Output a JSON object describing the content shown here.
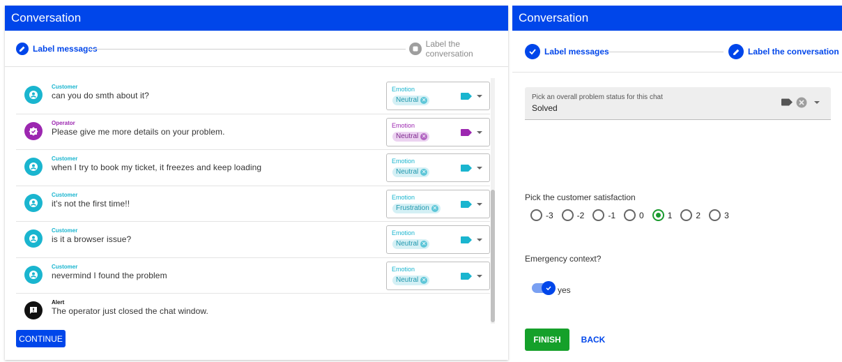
{
  "left_panel": {
    "title": "Conversation",
    "steps": [
      {
        "label": "Label messages",
        "state": "active"
      },
      {
        "label": "Label the conversation",
        "state": "inactive"
      }
    ],
    "messages": [
      {
        "sender": "Customer",
        "text": "can you do smth about it?",
        "emotion_label": "Emotion",
        "emotion": "Neutral"
      },
      {
        "sender": "Operator",
        "text": "Please give me more details on your problem.",
        "emotion_label": "Emotion",
        "emotion": "Neutral"
      },
      {
        "sender": "Customer",
        "text": "when I try to book my ticket, it freezes and keep loading",
        "emotion_label": "Emotion",
        "emotion": "Neutral"
      },
      {
        "sender": "Customer",
        "text": "it's not the first time!!",
        "emotion_label": "Emotion",
        "emotion": "Frustration"
      },
      {
        "sender": "Customer",
        "text": "is it a browser issue?",
        "emotion_label": "Emotion",
        "emotion": "Neutral"
      },
      {
        "sender": "Customer",
        "text": "nevermind I found the problem",
        "emotion_label": "Emotion",
        "emotion": "Neutral"
      }
    ],
    "alert": {
      "sender": "Alert",
      "text": "The operator just closed the chat window."
    },
    "continue_label": "CONTINUE"
  },
  "right_panel": {
    "title": "Conversation",
    "steps": [
      {
        "label": "Label messages",
        "state": "done"
      },
      {
        "label": "Label the conversation",
        "state": "active"
      }
    ],
    "problem_status": {
      "label": "Pick an overall problem status for this chat",
      "value": "Solved"
    },
    "satisfaction": {
      "label": "Pick the customer satisfaction",
      "options": [
        "-3",
        "-2",
        "-1",
        "0",
        "1",
        "2",
        "3"
      ],
      "selected": "1"
    },
    "emergency": {
      "label": "Emergency context?",
      "toggle_label": "yes",
      "on": true
    },
    "finish_label": "FINISH",
    "back_label": "BACK"
  },
  "colors": {
    "primary": "#0046ea",
    "customer": "#1ab5cf",
    "operator": "#9c27b0",
    "success": "#15a02a"
  }
}
